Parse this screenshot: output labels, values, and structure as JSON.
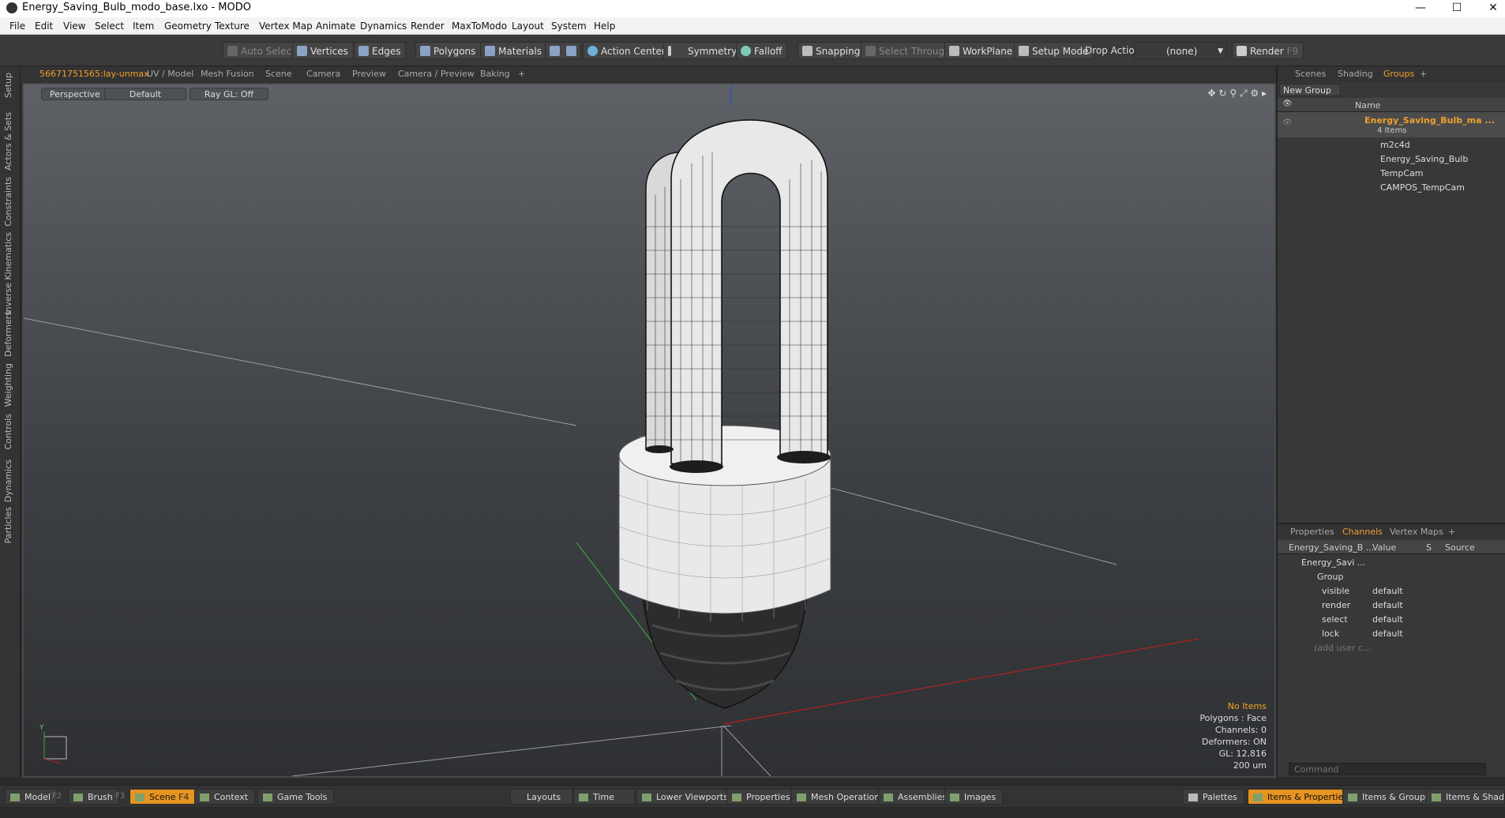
{
  "window": {
    "title": "Energy_Saving_Bulb_modo_base.lxo - MODO",
    "min": "—",
    "max": "☐",
    "close": "✕"
  },
  "menu": [
    "File",
    "Edit",
    "View",
    "Select",
    "Item",
    "Geometry",
    "Texture",
    "Vertex Map",
    "Animate",
    "Dynamics",
    "Render",
    "MaxToModo",
    "Layout",
    "System",
    "Help"
  ],
  "toolbar": {
    "auto_select": "Auto Select",
    "vertices": "Vertices",
    "edges": "Edges",
    "polygons": "Polygons",
    "materials": "Materials",
    "action_center": "Action Center",
    "symmetry": "Symmetry",
    "falloff": "Falloff",
    "snapping": "Snapping",
    "select_through": "Select Through",
    "workplane": "WorkPlane",
    "setup_mode": "Setup Mode",
    "drop_action": "Drop Action",
    "drop_value": "(none)",
    "render": "Render",
    "render_key": "F9"
  },
  "left_tabs": [
    "Setup",
    "Actors & Sets",
    "Constraints",
    "Inverse Kinematics",
    "Deformers",
    "Weighting",
    "Controls",
    "Dynamics",
    "Particles"
  ],
  "viewport_tabs": [
    "56671751565:lay-unmax",
    "UV / Model",
    "Mesh Fusion",
    "Scene",
    "Camera",
    "Preview",
    "Camera / Preview",
    "Baking",
    "+"
  ],
  "viewport": {
    "view": "Perspective",
    "shading": "Default",
    "raygl": "Ray GL: Off",
    "stats": {
      "items": "No Items",
      "polygons": "Polygons : Face",
      "channels": "Channels: 0",
      "deformers": "Deformers: ON",
      "gl": "GL: 12,816",
      "scale": "200 um"
    },
    "axis_y": "Y"
  },
  "scene_panel": {
    "tabs": [
      "Scenes",
      "Shading",
      "Groups",
      "+"
    ],
    "new_group": "New Group",
    "name_header": "Name",
    "group_name": "Energy_Saving_Bulb_ma ...",
    "group_count": "4 Items",
    "items": [
      "m2c4d",
      "Energy_Saving_Bulb",
      "TempCam",
      "CAMPOS_TempCam"
    ]
  },
  "channels_panel": {
    "tabs": [
      "Properties",
      "Channels",
      "Vertex Maps",
      "+"
    ],
    "headers": {
      "name": "Energy_Saving_B ...",
      "value": "Value",
      "s": "S",
      "source": "Source"
    },
    "root": "Energy_Savi ...",
    "group": "Group",
    "rows": [
      {
        "name": "visible",
        "value": "default"
      },
      {
        "name": "render",
        "value": "default"
      },
      {
        "name": "select",
        "value": "default"
      },
      {
        "name": "lock",
        "value": "default"
      }
    ],
    "add_user": "(add user c...",
    "command_placeholder": "Command"
  },
  "statusbar": {
    "model": "Model",
    "f2": "F2",
    "brush": "Brush",
    "f3": "F3",
    "scene": "Scene",
    "f4": "F4",
    "context": "Context",
    "game_tools": "Game Tools",
    "layouts": "Layouts",
    "time": "Time",
    "lower_viewports": "Lower Viewports",
    "properties": "Properties",
    "mesh_operations": "Mesh Operations",
    "assemblies": "Assemblies",
    "images": "Images",
    "palettes": "Palettes",
    "items_properties": "Items & Properties",
    "items_groups": "Items & Groups",
    "items_shading": "Items & Shading"
  }
}
